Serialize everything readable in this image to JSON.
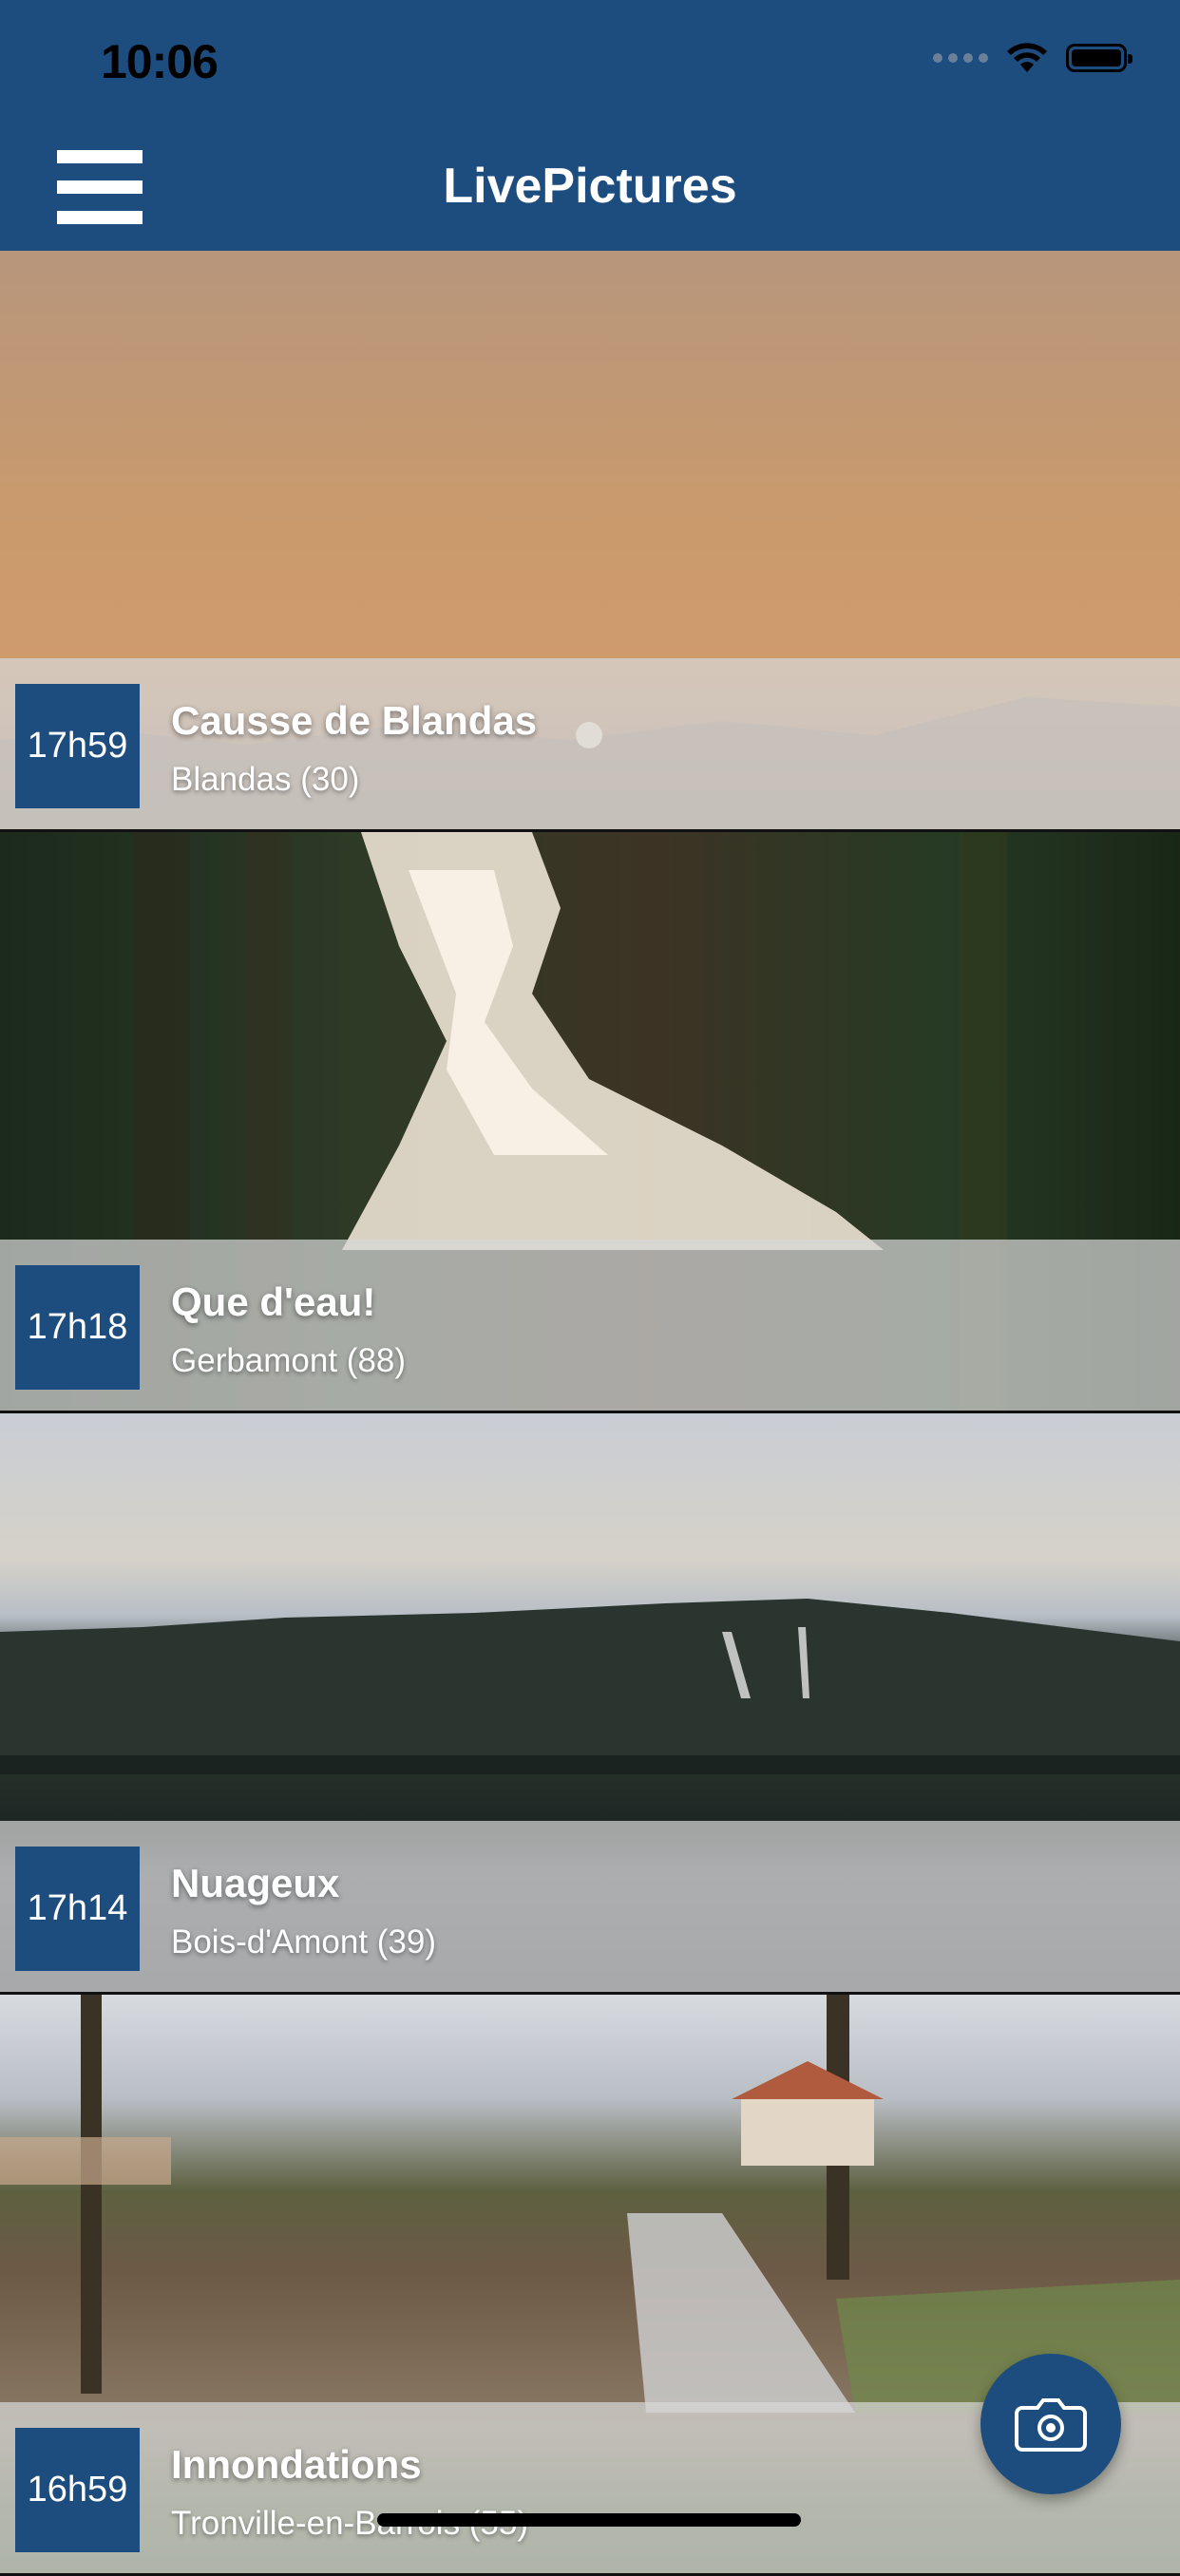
{
  "status_bar": {
    "time": "10:06"
  },
  "header": {
    "title": "LivePictures",
    "menu_icon": "hamburger-menu-icon"
  },
  "feed": [
    {
      "time": "17h59",
      "title": "Causse de Blandas",
      "location": "Blandas (30)"
    },
    {
      "time": "17h18",
      "title": "Que d'eau!",
      "location": "Gerbamont (88)"
    },
    {
      "time": "17h14",
      "title": "Nuageux",
      "location": "Bois-d'Amont (39)"
    },
    {
      "time": "16h59",
      "title": "Innondations",
      "location": "Tronville-en-Barrois (55)"
    }
  ],
  "fab": {
    "icon": "camera-icon"
  },
  "colors": {
    "primary": "#1d4c7e",
    "caption_overlay": "#d7d7d7"
  }
}
